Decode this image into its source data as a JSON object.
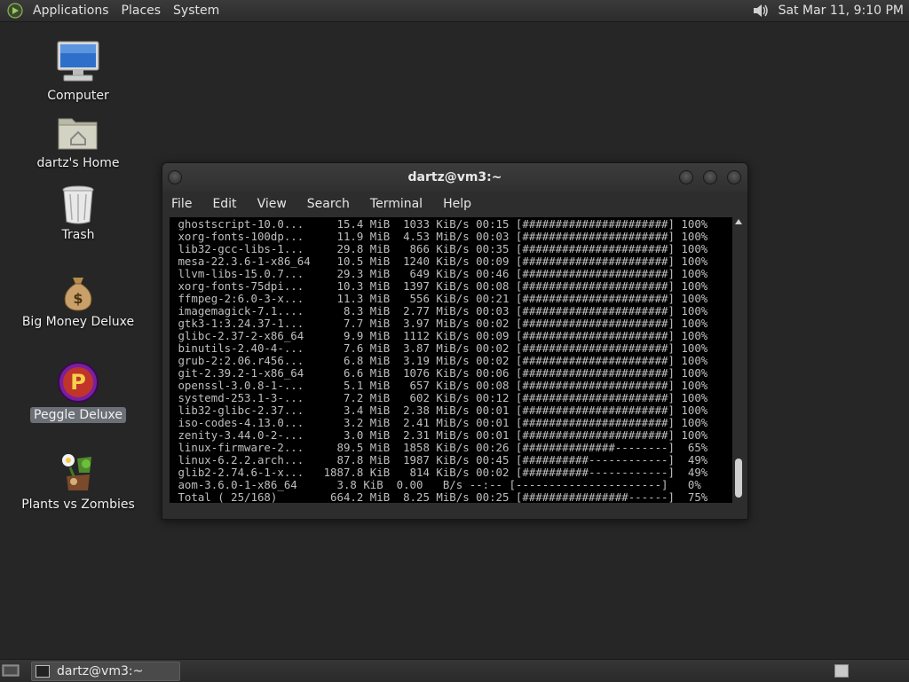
{
  "top_panel": {
    "menus": [
      "Applications",
      "Places",
      "System"
    ],
    "clock": "Sat Mar 11,  9:10 PM"
  },
  "desktop": {
    "icons": [
      {
        "label": "Computer"
      },
      {
        "label": "dartz's Home"
      },
      {
        "label": "Trash"
      },
      {
        "label": "Big Money Deluxe"
      },
      {
        "label": "Peggle Deluxe"
      },
      {
        "label": "Plants vs Zombies"
      }
    ]
  },
  "window": {
    "title": "dartz@vm3:~",
    "menus": [
      "File",
      "Edit",
      "View",
      "Search",
      "Terminal",
      "Help"
    ],
    "lines": [
      " ghostscript-10.0...     15.4 MiB  1033 KiB/s 00:15 [######################] 100%",
      " xorg-fonts-100dp...     11.9 MiB  4.53 MiB/s 00:03 [######################] 100%",
      " lib32-gcc-libs-1...     29.8 MiB   866 KiB/s 00:35 [######################] 100%",
      " mesa-22.3.6-1-x86_64    10.5 MiB  1240 KiB/s 00:09 [######################] 100%",
      " llvm-libs-15.0.7...     29.3 MiB   649 KiB/s 00:46 [######################] 100%",
      " xorg-fonts-75dpi...     10.3 MiB  1397 KiB/s 00:08 [######################] 100%",
      " ffmpeg-2:6.0-3-x...     11.3 MiB   556 KiB/s 00:21 [######################] 100%",
      " imagemagick-7.1....      8.3 MiB  2.77 MiB/s 00:03 [######################] 100%",
      " gtk3-1:3.24.37-1...      7.7 MiB  3.97 MiB/s 00:02 [######################] 100%",
      " glibc-2.37-2-x86_64      9.9 MiB  1112 KiB/s 00:09 [######################] 100%",
      " binutils-2.40-4-...      7.6 MiB  3.87 MiB/s 00:02 [######################] 100%",
      " grub-2:2.06.r456...      6.8 MiB  3.19 MiB/s 00:02 [######################] 100%",
      " git-2.39.2-1-x86_64      6.6 MiB  1076 KiB/s 00:06 [######################] 100%",
      " openssl-3.0.8-1-...      5.1 MiB   657 KiB/s 00:08 [######################] 100%",
      " systemd-253.1-3-...      7.2 MiB   602 KiB/s 00:12 [######################] 100%",
      " lib32-glibc-2.37...      3.4 MiB  2.38 MiB/s 00:01 [######################] 100%",
      " iso-codes-4.13.0...      3.2 MiB  2.41 MiB/s 00:01 [######################] 100%",
      " zenity-3.44.0-2-...      3.0 MiB  2.31 MiB/s 00:01 [######################] 100%",
      " linux-firmware-2...     89.5 MiB  1858 KiB/s 00:26 [##############--------]  65%",
      " linux-6.2.2.arch...     87.8 MiB  1987 KiB/s 00:45 [##########------------]  49%",
      " glib2-2.74.6-1-x...   1887.8 KiB   814 KiB/s 00:02 [##########------------]  49%",
      " aom-3.6.0-1-x86_64      3.8 KiB  0.00   B/s --:-- [----------------------]   0%",
      " Total ( 25/168)        664.2 MiB  8.25 MiB/s 00:25 [################------]  75%"
    ]
  },
  "taskbar": {
    "task_label": "dartz@vm3:~"
  }
}
